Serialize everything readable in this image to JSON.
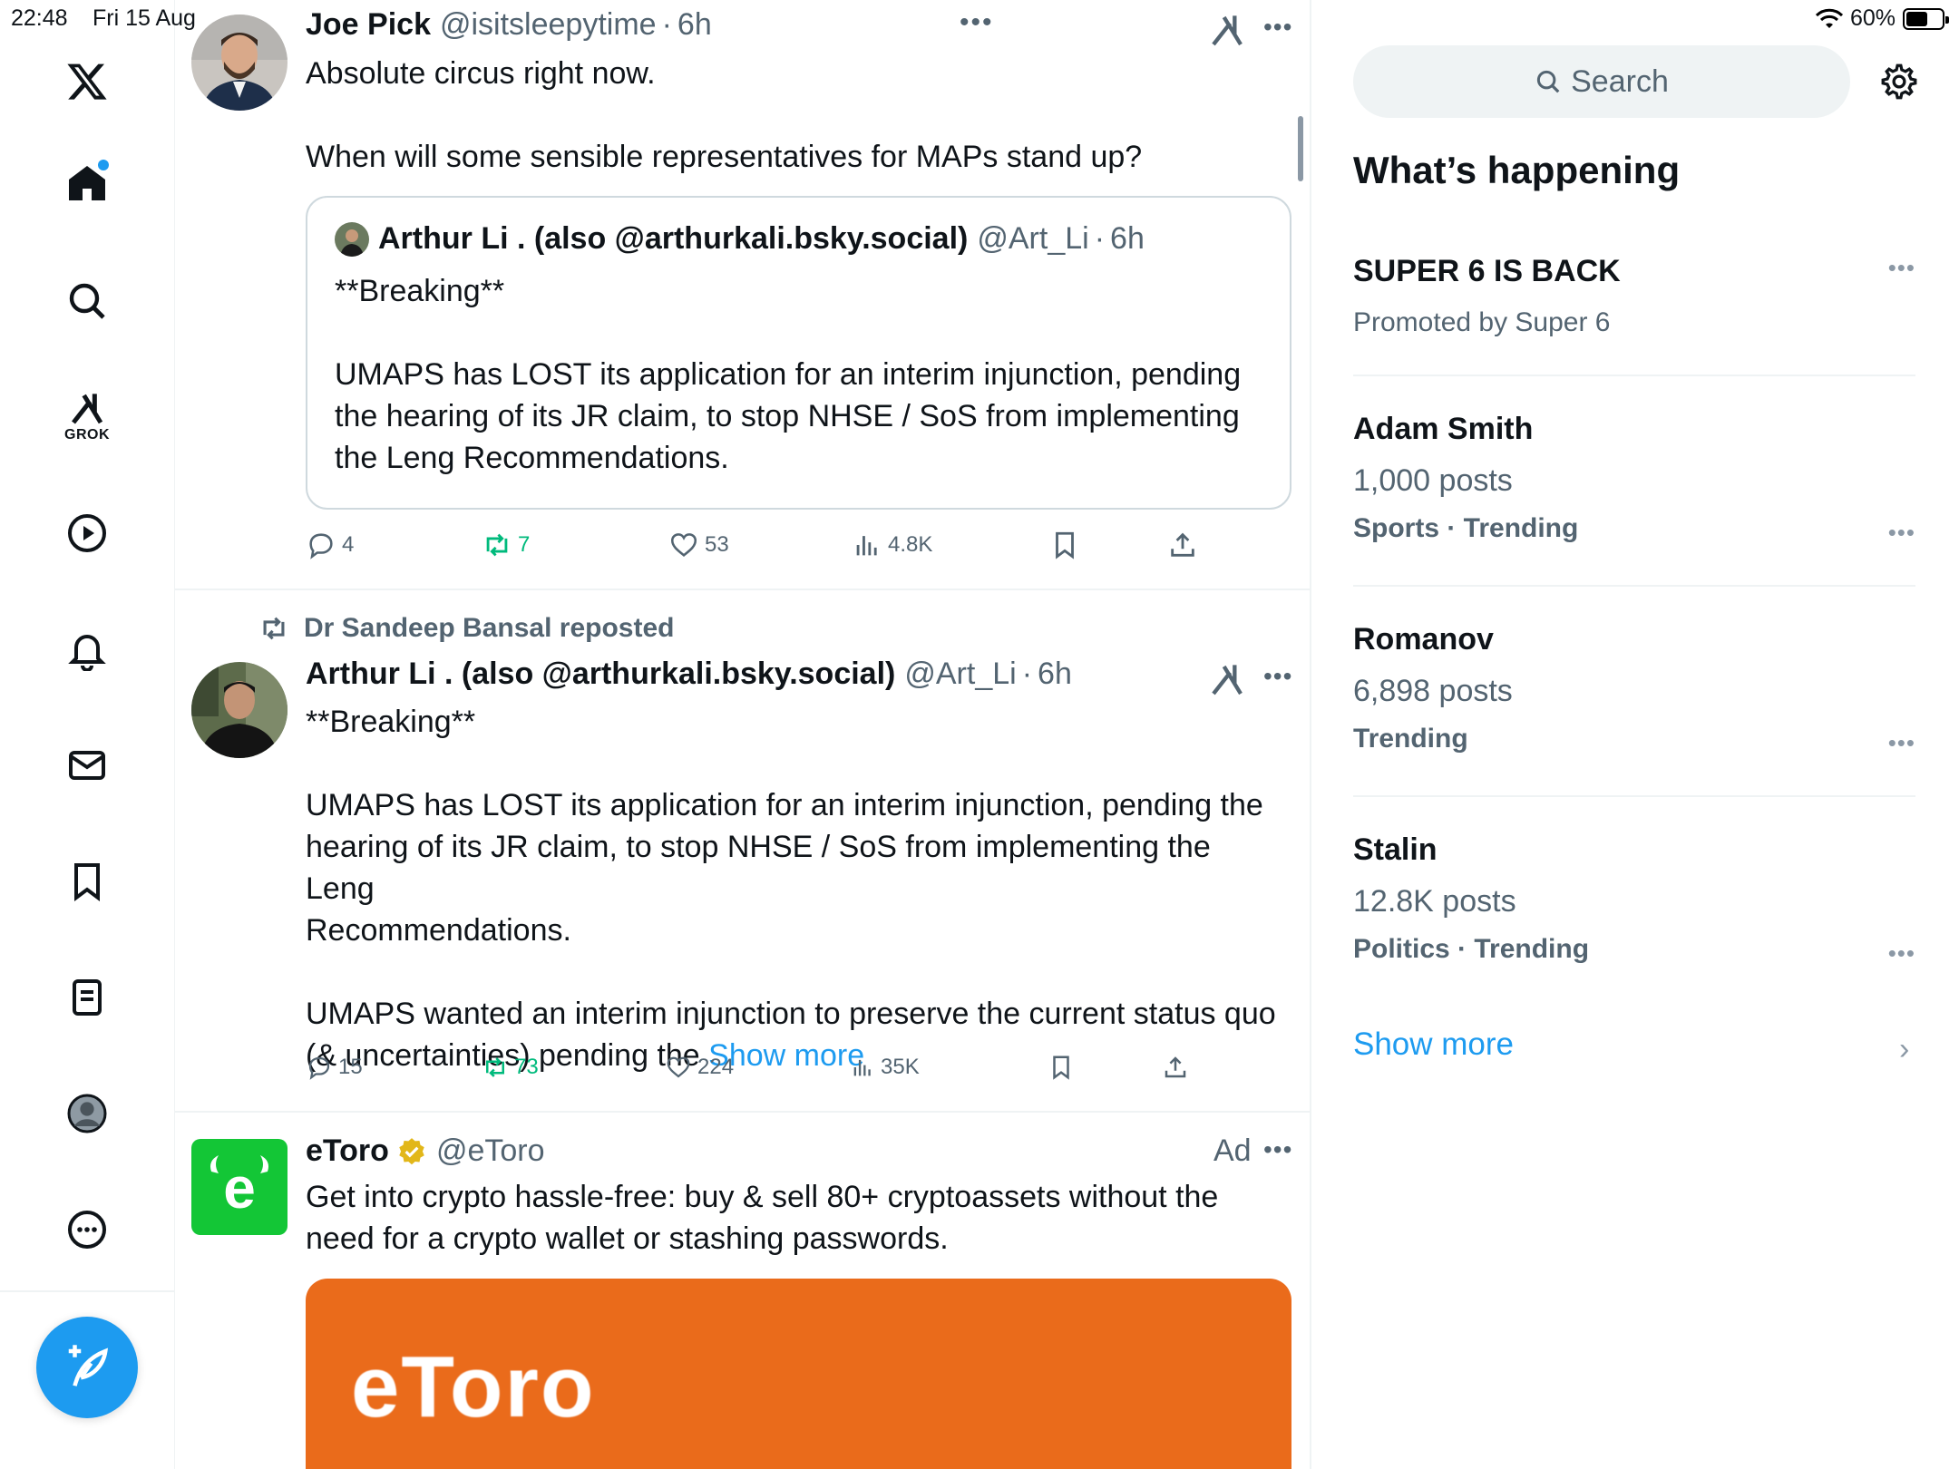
{
  "status_bar": {
    "time": "22:48",
    "date": "Fri 15 Aug",
    "battery": "60%",
    "battery_level": 0.6
  },
  "sidebar": {
    "items": [
      {
        "name": "x-logo",
        "label": ""
      },
      {
        "name": "home",
        "label": ""
      },
      {
        "name": "explore",
        "label": ""
      },
      {
        "name": "grok",
        "label": "GROK"
      },
      {
        "name": "video",
        "label": ""
      },
      {
        "name": "notifications",
        "label": ""
      },
      {
        "name": "messages",
        "label": ""
      },
      {
        "name": "bookmarks",
        "label": ""
      },
      {
        "name": "lists",
        "label": ""
      },
      {
        "name": "profile",
        "label": ""
      },
      {
        "name": "more",
        "label": ""
      }
    ]
  },
  "timeline": {
    "posts": [
      {
        "name": "Joe Pick",
        "handle": "@isitsleepytime",
        "time": "6h",
        "text_lines": [
          "Absolute circus right now.",
          "",
          "When will some sensible representatives for MAPs stand up?"
        ],
        "quote": {
          "name": "Arthur Li . (also @arthurkali.bsky.social)",
          "handle": "@Art_Li",
          "time": "6h",
          "text_lines": [
            "**Breaking**",
            "",
            "UMAPS has LOST its application for an interim injunction, pending",
            "the hearing of its JR claim, to stop NHSE / SoS from implementing",
            "the Leng Recommendations."
          ]
        },
        "actions": {
          "replies": "4",
          "reposts": "7",
          "likes": "53",
          "views": "4.8K"
        }
      },
      {
        "repost_by": "Dr Sandeep Bansal reposted",
        "name": "Arthur Li . (also @arthurkali.bsky.social)",
        "handle": "@Art_Li",
        "time": "6h",
        "text_lines": [
          "**Breaking**",
          "",
          "UMAPS has LOST its application for an interim injunction, pending the",
          "hearing of its JR claim, to stop NHSE / SoS from implementing the Leng",
          "Recommendations.",
          "",
          "UMAPS wanted an interim injunction to preserve the current status quo"
        ],
        "last_line": "(& uncertainties) pending the",
        "show_more": "Show more",
        "actions": {
          "replies": "15",
          "reposts": "73",
          "likes": "224",
          "views": "35K"
        }
      },
      {
        "name": "eToro",
        "handle": "@eToro",
        "ad_label": "Ad",
        "text_lines": [
          "Get into crypto hassle-free: buy & sell 80+ cryptoassets without the",
          "need for a crypto wallet or stashing passwords."
        ],
        "banner_text": "eToro"
      }
    ]
  },
  "right": {
    "search_placeholder": "Search",
    "section_title": "What’s happening",
    "promoted": {
      "title": "SUPER 6 IS BACK",
      "subtitle": "Promoted by Super 6"
    },
    "trends": [
      {
        "title": "Adam Smith",
        "posts": "1,000 posts",
        "meta": "Sports · Trending"
      },
      {
        "title": "Romanov",
        "posts": "6,898 posts",
        "meta": "Trending"
      },
      {
        "title": "Stalin",
        "posts": "12.8K posts",
        "meta": "Politics · Trending"
      }
    ],
    "show_more": "Show more"
  },
  "colors": {
    "accent": "#1d9bf0",
    "repost_green": "#00ba7c",
    "secondary_text": "#536471",
    "etoro_green": "#13c636",
    "etoro_orange": "#ea6b1b"
  }
}
